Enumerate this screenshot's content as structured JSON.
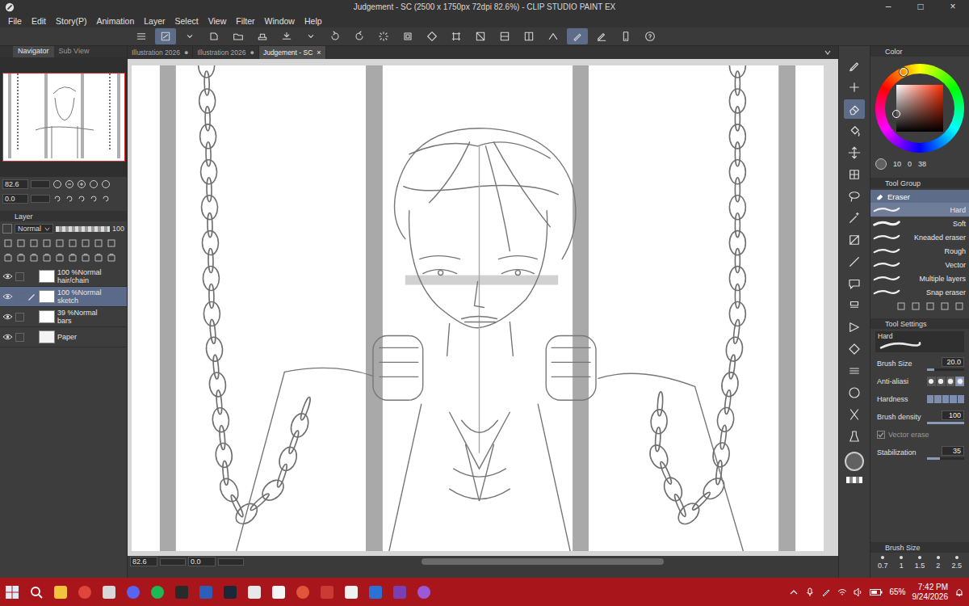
{
  "window": {
    "title": "Judgement - SC (2500 x 1750px 72dpi 82.6%) - CLIP STUDIO PAINT EX",
    "controls": [
      "–",
      "□",
      "×"
    ]
  },
  "menu": [
    "File",
    "Edit",
    "Story(P)",
    "Animation",
    "Layer",
    "Select",
    "View",
    "Filter",
    "Window",
    "Help"
  ],
  "toolbar": [
    {
      "selected": false
    },
    {
      "selected": true
    },
    {
      "selected": false
    },
    {
      "selected": false
    },
    {
      "selected": false
    },
    {
      "selected": false
    },
    {
      "selected": false
    },
    {
      "selected": false
    },
    {
      "selected": false
    },
    {
      "selected": false
    },
    {
      "selected": false
    },
    {
      "selected": false
    },
    {
      "selected": false
    },
    {
      "selected": false
    },
    {
      "selected": false
    },
    {
      "selected": false
    },
    {
      "selected": false
    },
    {
      "selected": false
    },
    {
      "selected": true
    },
    {
      "selected": false
    },
    {
      "selected": false
    },
    {
      "selected": false
    }
  ],
  "navigator": {
    "tabs": [
      {
        "label": "Navigator",
        "selected": true
      },
      {
        "label": "Sub View",
        "selected": false
      }
    ],
    "zoom": "82.6",
    "angle": "0.0"
  },
  "layer_panel": {
    "title": "Layer",
    "blend": "Normal",
    "opacity": "100",
    "layers": [
      {
        "kind": "raster",
        "opacity": "100 %",
        "blend": "Normal",
        "name": "hair/chain",
        "visible": true,
        "selected": false
      },
      {
        "kind": "raster",
        "opacity": "100 %",
        "blend": "Normal",
        "name": "sketch",
        "visible": true,
        "selected": true
      },
      {
        "kind": "raster",
        "opacity": "39 %",
        "blend": "Normal",
        "name": "bars",
        "visible": true,
        "selected": false
      },
      {
        "kind": "paper",
        "name": "Paper",
        "visible": true,
        "selected": false
      }
    ]
  },
  "documents": [
    {
      "label": "Illustration 2026",
      "mark": "●",
      "selected": false
    },
    {
      "label": "Illustration 2026",
      "mark": "●",
      "selected": false
    },
    {
      "label": "Judgement - SC",
      "mark": "×",
      "selected": true
    }
  ],
  "status_bar": {
    "zoom": "82.6",
    "angle": "0.0"
  },
  "tools": [
    {
      "selected": false
    },
    {
      "selected": false
    },
    {
      "selected": true
    },
    {
      "selected": false
    },
    {
      "selected": false
    },
    {
      "selected": false
    },
    {
      "selected": false
    },
    {
      "selected": false
    },
    {
      "selected": false
    },
    {
      "selected": false
    },
    {
      "selected": false
    },
    {
      "selected": false
    },
    {
      "selected": false
    },
    {
      "selected": false
    },
    {
      "selected": false
    },
    {
      "selected": false
    },
    {
      "selected": false
    },
    {
      "selected": false
    }
  ],
  "color_panel": {
    "title": "Color",
    "hue": "10",
    "saturation": "0",
    "value": "38"
  },
  "tool_group": {
    "title": "Tool Group",
    "tool": "Eraser",
    "subtools": [
      {
        "label": "Hard",
        "selected": true
      },
      {
        "label": "Soft",
        "selected": false
      },
      {
        "label": "Kneaded eraser",
        "selected": false
      },
      {
        "label": "Rough",
        "selected": false
      },
      {
        "label": "Vector",
        "selected": false
      },
      {
        "label": "Multiple layers",
        "selected": false
      },
      {
        "label": "Snap eraser",
        "selected": false
      }
    ]
  },
  "tool_settings": {
    "title": "Tool Settings",
    "preview": "Hard",
    "rows": [
      {
        "kind": "slider",
        "label": "Brush Size",
        "value": "20.0",
        "level": 0.2
      },
      {
        "kind": "options",
        "label": "Anti-aliasi",
        "options": [
          {
            "selected": false
          },
          {
            "selected": false
          },
          {
            "selected": false
          },
          {
            "selected": true
          }
        ]
      },
      {
        "kind": "meter",
        "label": "Hardness",
        "level": 1
      },
      {
        "kind": "slider",
        "label": "Brush density",
        "value": "100",
        "level": 1
      },
      {
        "kind": "check",
        "label": "Vector erase",
        "checked": true,
        "disabled": true
      },
      {
        "kind": "slider",
        "label": "Stabilization",
        "value": "35",
        "level": 0.35
      }
    ]
  },
  "brush_size": {
    "title": "Brush Size",
    "sizes": [
      "0.7",
      "1",
      "1.5",
      "2",
      "2.5"
    ]
  },
  "taskbar": {
    "battery": "65%",
    "time": "7:42 PM",
    "date": "9/24/2026"
  }
}
